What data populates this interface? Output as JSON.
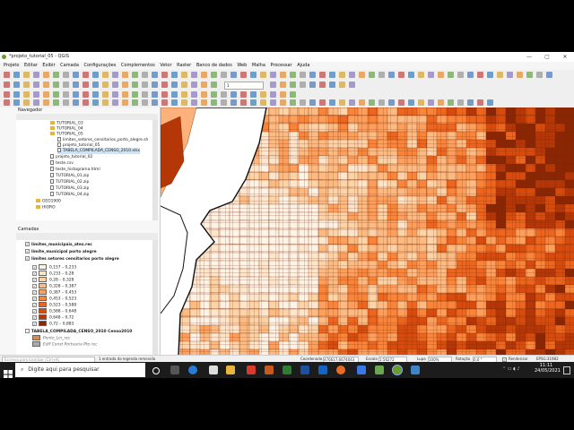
{
  "window": {
    "title": "*projeto_tutorial_05 - QGIS",
    "min": "—",
    "max": "▢",
    "close": "✕"
  },
  "menu": [
    "Projeto",
    "Editar",
    "Exibir",
    "Camada",
    "Configurações",
    "Complementos",
    "Vetor",
    "Raster",
    "Banco de dados",
    "Web",
    "Malha",
    "Processar",
    "Ajuda"
  ],
  "toolbar": {
    "scale_combo": "1"
  },
  "navigator": {
    "title": "Navegador",
    "items": [
      {
        "label": "TUTORIAL_03",
        "kind": "folder"
      },
      {
        "label": "TUTORIAL_04",
        "kind": "folder"
      },
      {
        "label": "TUTORIAL_05",
        "kind": "folder"
      },
      {
        "label": "limites_setores_censitarios_porto_alegre.sh",
        "kind": "doc"
      },
      {
        "label": "projeto_tutorial_05",
        "kind": "doc"
      },
      {
        "label": "TABELA_COMPILADA_CENSO_2010.xlsx",
        "kind": "doc"
      },
      {
        "label": "projeto_tutorial_02",
        "kind": "doc"
      },
      {
        "label": "teste.csv",
        "kind": "doc"
      },
      {
        "label": "teste_histograma.html",
        "kind": "doc"
      },
      {
        "label": "TUTORIAL_01.zip",
        "kind": "doc"
      },
      {
        "label": "TUTORIAL_02.zip",
        "kind": "doc"
      },
      {
        "label": "TUTORIAL_03.zip",
        "kind": "doc"
      },
      {
        "label": "TUTORIAL_04.zip",
        "kind": "doc"
      },
      {
        "label": "GEO1900",
        "kind": "folder"
      },
      {
        "label": "HIORO",
        "kind": "folder"
      }
    ]
  },
  "layers": {
    "title": "Camadas",
    "items": [
      {
        "label": "limites_municipais_ates.rec"
      },
      {
        "label": "limite_municipal porto alegre"
      },
      {
        "label": "limites setores censitarios porto alegre"
      }
    ],
    "legend": [
      {
        "label": "0,157 – 0,233",
        "color": "#fff3e6"
      },
      {
        "label": "0,233 – 0,28",
        "color": "#fee6cc"
      },
      {
        "label": "0,28 – 0,328",
        "color": "#fdd3a8"
      },
      {
        "label": "0,328 – 0,387",
        "color": "#fdbb84"
      },
      {
        "label": "0,387 – 0,453",
        "color": "#fda05e"
      },
      {
        "label": "0,453 – 0,523",
        "color": "#f9853b"
      },
      {
        "label": "0,523 – 0,588",
        "color": "#ec6620"
      },
      {
        "label": "0,588 – 0,648",
        "color": "#d74c0e"
      },
      {
        "label": "0,648 – 0,72",
        "color": "#b53606"
      },
      {
        "label": "0,72 – 0,883",
        "color": "#8a2604"
      }
    ],
    "tabela": "TABELA_COMPILADA_CENSO_2010 Censo2010",
    "extra1": "Ponto_Lin_rec",
    "extra2": "Edif Const Portuaria Pto rec"
  },
  "status": {
    "search_placeholder": "Escreva para localizar (Ctrl+K)",
    "message": "1 entrada da legenda removida",
    "coord_label": "Coordenada",
    "coord_value": "476617,6674043",
    "scale_label": "Escala",
    "scale_value": "1:56272",
    "lupa_label": "Lupa",
    "lupa_value": "100%",
    "rot_label": "Rotação",
    "rot_value": "0,0 °",
    "render_label": "Renderizar",
    "epsg": "EPSG:31982"
  },
  "taskbar": {
    "search_text": "Digite aqui para pesquisar",
    "time": "11:11",
    "date": "24/05/2021"
  }
}
